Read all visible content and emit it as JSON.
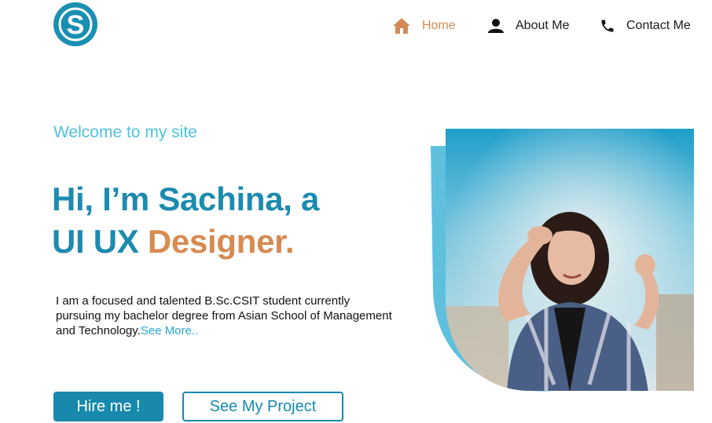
{
  "brand": {
    "logo_letter": "S"
  },
  "nav": {
    "items": [
      {
        "label": "Home",
        "icon": "home-icon",
        "active": true
      },
      {
        "label": "About Me",
        "icon": "person-icon",
        "active": false
      },
      {
        "label": "Contact Me",
        "icon": "phone-icon",
        "active": false
      }
    ]
  },
  "hero": {
    "welcome": "Welcome to my site",
    "headline_line1": "Hi, I’m Sachina, a",
    "headline_line2_prefix": "UI UX ",
    "headline_line2_accent": "Designer.",
    "intro_text": "I am a focused and talented B.Sc.CSIT student currently pursuing my bachelor degree from Asian School of Management and Technology.",
    "see_more": "See More..",
    "photo": "portrait-photo"
  },
  "buttons": {
    "hire": "Hire me !",
    "projects": "See My Project"
  },
  "colors": {
    "primary": "#1d8bb0",
    "accent": "#d68b52",
    "light_blue": "#4ec2de"
  }
}
